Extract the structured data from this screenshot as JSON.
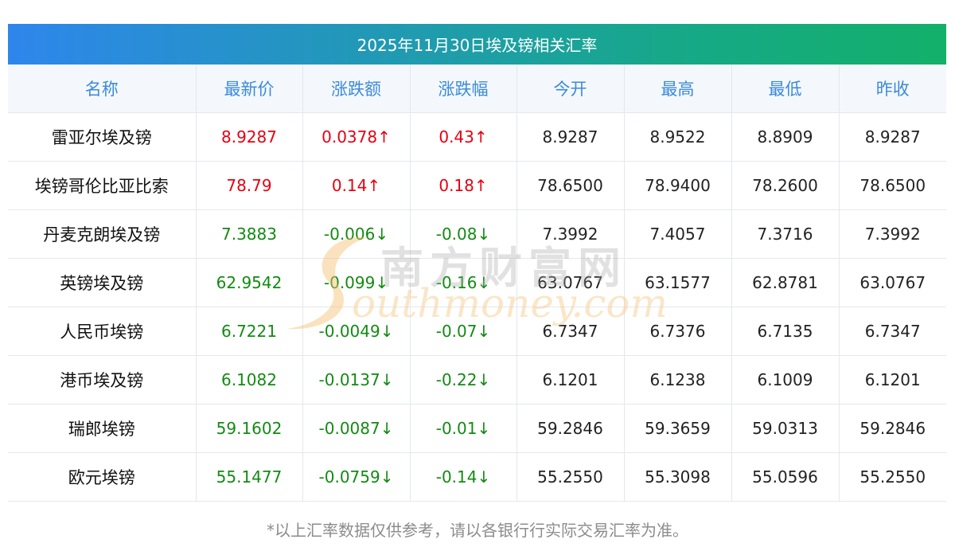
{
  "title": "2025年11月30日埃及镑相关汇率",
  "headers": [
    "名称",
    "最新价",
    "涨跌额",
    "涨跌幅",
    "今开",
    "最高",
    "最低",
    "昨收"
  ],
  "rows": [
    {
      "name": "雷亚尔埃及镑",
      "latest": "8.9287",
      "change": "0.0378↑",
      "pct": "0.43↑",
      "open": "8.9287",
      "high": "8.9522",
      "low": "8.8909",
      "prev": "8.9287",
      "dir": "up"
    },
    {
      "name": "埃镑哥伦比亚比索",
      "latest": "78.79",
      "change": "0.14↑",
      "pct": "0.18↑",
      "open": "78.6500",
      "high": "78.9400",
      "low": "78.2600",
      "prev": "78.6500",
      "dir": "up"
    },
    {
      "name": "丹麦克朗埃及镑",
      "latest": "7.3883",
      "change": "-0.006↓",
      "pct": "-0.08↓",
      "open": "7.3992",
      "high": "7.4057",
      "low": "7.3716",
      "prev": "7.3992",
      "dir": "down"
    },
    {
      "name": "英镑埃及镑",
      "latest": "62.9542",
      "change": "-0.099↓",
      "pct": "-0.16↓",
      "open": "63.0767",
      "high": "63.1577",
      "low": "62.8781",
      "prev": "63.0767",
      "dir": "down"
    },
    {
      "name": "人民币埃镑",
      "latest": "6.7221",
      "change": "-0.0049↓",
      "pct": "-0.07↓",
      "open": "6.7347",
      "high": "6.7376",
      "low": "6.7135",
      "prev": "6.7347",
      "dir": "down"
    },
    {
      "name": "港币埃及镑",
      "latest": "6.1082",
      "change": "-0.0137↓",
      "pct": "-0.22↓",
      "open": "6.1201",
      "high": "6.1238",
      "low": "6.1009",
      "prev": "6.1201",
      "dir": "down"
    },
    {
      "name": "瑞郎埃镑",
      "latest": "59.1602",
      "change": "-0.0087↓",
      "pct": "-0.01↓",
      "open": "59.2846",
      "high": "59.3659",
      "low": "59.0313",
      "prev": "59.2846",
      "dir": "down"
    },
    {
      "name": "欧元埃镑",
      "latest": "55.1477",
      "change": "-0.0759↓",
      "pct": "-0.14↓",
      "open": "55.2550",
      "high": "55.3098",
      "low": "55.0596",
      "prev": "55.2550",
      "dir": "down"
    }
  ],
  "footnote": "*以上汇率数据仅供参考，请以各银行行实际交易汇率为准。",
  "watermark": {
    "cn": "南方财富网",
    "en": "outhmoney.com"
  },
  "colors": {
    "up": "#e60012",
    "down": "#138a13",
    "header_text": "#3b8ad9",
    "title_start": "#2e86ec",
    "title_end": "#13b06a"
  }
}
